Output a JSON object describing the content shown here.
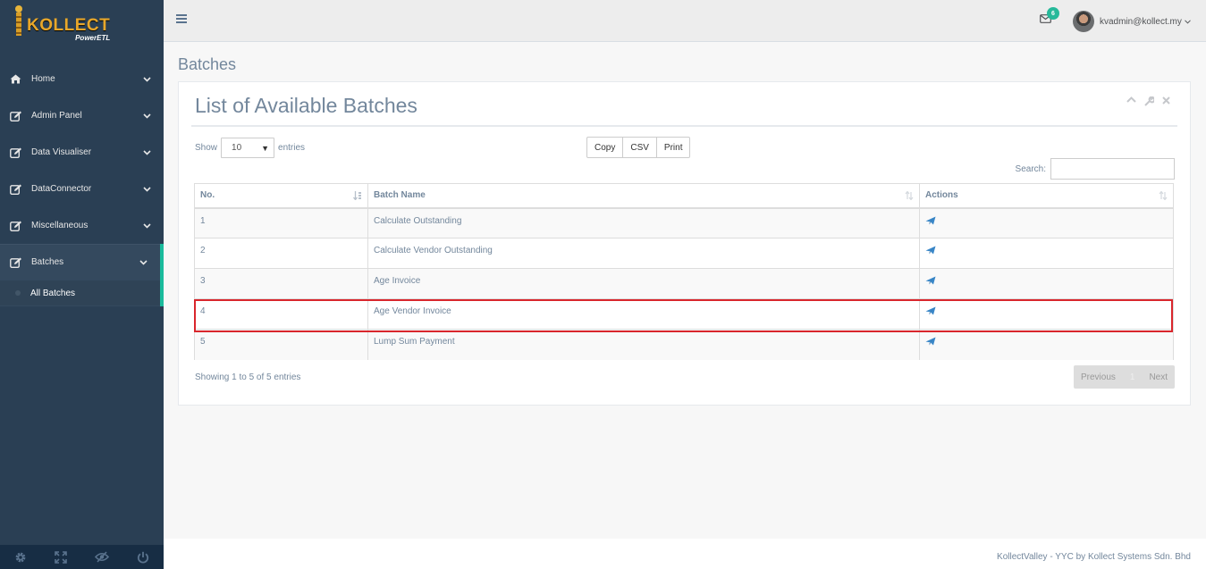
{
  "brand": {
    "title": "KOLLECT",
    "subtitle": "PowerETL"
  },
  "sidebar": {
    "items": [
      {
        "label": "Home",
        "icon": "home-icon"
      },
      {
        "label": "Admin Panel",
        "icon": "edit-icon"
      },
      {
        "label": "Data Visualiser",
        "icon": "edit-icon"
      },
      {
        "label": "DataConnector",
        "icon": "edit-icon"
      },
      {
        "label": "Miscellaneous",
        "icon": "edit-icon"
      },
      {
        "label": "Batches",
        "icon": "edit-icon",
        "active": true
      }
    ],
    "submenu": [
      {
        "label": "All Batches"
      }
    ],
    "footer_icons": [
      "settings-icon",
      "fullscreen-icon",
      "lock-icon",
      "logout-icon"
    ]
  },
  "topnav": {
    "notification_count": "6",
    "user_email": "kvadmin@kollect.my"
  },
  "page": {
    "title": "Batches"
  },
  "panel": {
    "title": "List of Available Batches",
    "show_label": "Show",
    "entries_label": "entries",
    "page_length": "10",
    "buttons": {
      "copy": "Copy",
      "csv": "CSV",
      "print": "Print"
    },
    "search_label": "Search:",
    "search_value": "",
    "columns": [
      "No.",
      "Batch Name",
      "Actions"
    ],
    "rows": [
      {
        "no": "1",
        "name": "Calculate Outstanding"
      },
      {
        "no": "2",
        "name": "Calculate Vendor Outstanding"
      },
      {
        "no": "3",
        "name": "Age Invoice"
      },
      {
        "no": "4",
        "name": "Age Vendor Invoice",
        "highlighted": true
      },
      {
        "no": "5",
        "name": "Lump Sum Payment"
      }
    ],
    "info": "Showing 1 to 5 of 5 entries",
    "pager": {
      "previous": "Previous",
      "current": "1",
      "next": "Next"
    }
  },
  "footer": {
    "text": "KollectValley - YYC by Kollect Systems Sdn. Bhd"
  },
  "colors": {
    "sidebar_bg": "#2a3f54",
    "accent": "#1abb9c",
    "highlight_border": "#d9262c",
    "action_icon": "#3a87c8"
  }
}
